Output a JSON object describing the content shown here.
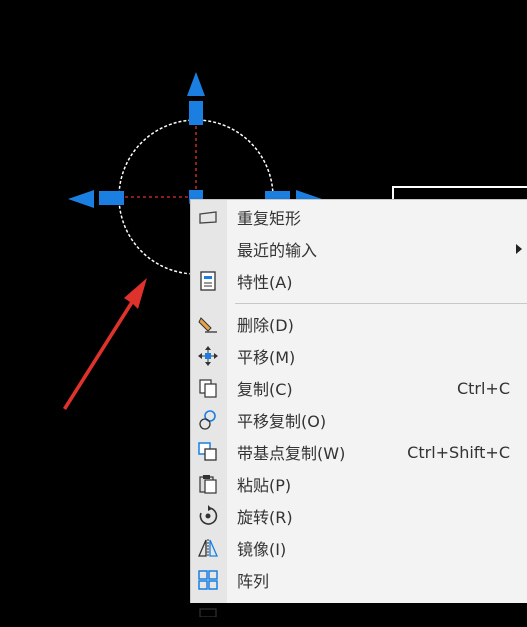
{
  "colors": {
    "grip": "#1a7fe0",
    "arrow": "#e0322d",
    "menu_bg": "#f3f3f3"
  },
  "menu": {
    "items": [
      {
        "label": "重复矩形",
        "shortcut": "",
        "icon": "rectangle-icon",
        "submenu": false
      },
      {
        "label": "最近的输入",
        "shortcut": "",
        "icon": "",
        "submenu": true
      },
      {
        "label": "特性(A)",
        "shortcut": "",
        "icon": "properties-icon",
        "submenu": false
      },
      {
        "label": "删除(D)",
        "shortcut": "",
        "icon": "erase-icon",
        "submenu": false
      },
      {
        "label": "平移(M)",
        "shortcut": "",
        "icon": "move-icon",
        "submenu": false
      },
      {
        "label": "复制(C)",
        "shortcut": "Ctrl+C",
        "icon": "copy-icon",
        "submenu": false
      },
      {
        "label": "平移复制(O)",
        "shortcut": "",
        "icon": "move-copy-icon",
        "submenu": false
      },
      {
        "label": "带基点复制(W)",
        "shortcut": "Ctrl+Shift+C",
        "icon": "copy-base-point-icon",
        "submenu": false
      },
      {
        "label": "粘贴(P)",
        "shortcut": "",
        "icon": "paste-icon",
        "submenu": false
      },
      {
        "label": "旋转(R)",
        "shortcut": "",
        "icon": "rotate-icon",
        "submenu": false
      },
      {
        "label": "镜像(I)",
        "shortcut": "",
        "icon": "mirror-icon",
        "submenu": false
      },
      {
        "label": "阵列",
        "shortcut": "",
        "icon": "array-icon",
        "submenu": false
      }
    ]
  }
}
